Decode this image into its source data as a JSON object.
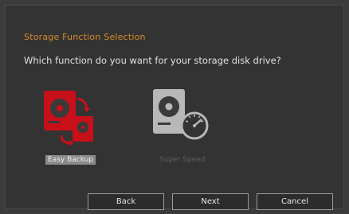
{
  "dialog": {
    "title": "Storage Function Selection",
    "question": "Which function do you want for your storage disk drive?"
  },
  "options": [
    {
      "label": "Easy Backup",
      "icon": "backup-drives-icon",
      "selected": true,
      "color": "#c8101a"
    },
    {
      "label": "Super Speed",
      "icon": "speed-drive-icon",
      "selected": false,
      "color": "#b8b8b8"
    }
  ],
  "buttons": {
    "back": "Back",
    "next": "Next",
    "cancel": "Cancel"
  },
  "colors": {
    "title": "#d98a2a",
    "accent_red": "#c8101a",
    "disabled_gray": "#b8b8b8"
  }
}
